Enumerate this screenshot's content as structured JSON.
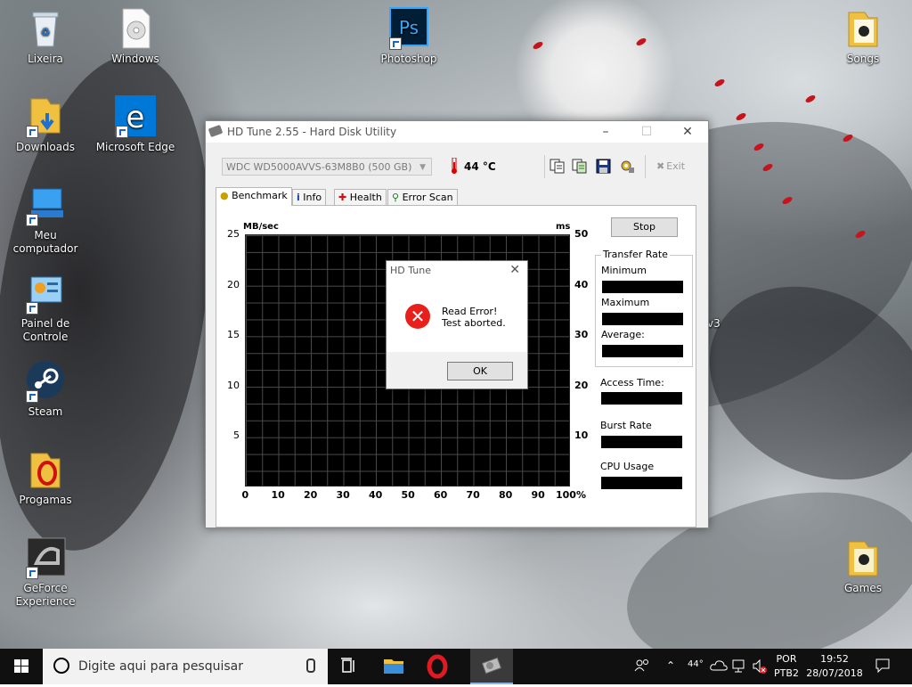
{
  "desktop": {
    "icons": [
      {
        "label": "Lixeira"
      },
      {
        "label": "Windows"
      },
      {
        "label": "Photoshop"
      },
      {
        "label": "Songs"
      },
      {
        "label": "Downloads"
      },
      {
        "label": "Microsoft Edge"
      },
      {
        "label": "Meu computador"
      },
      {
        "label": "Painel de Controle"
      },
      {
        "label": "Steam"
      },
      {
        "label": "Progamas"
      },
      {
        "label": "GeForce Experience"
      },
      {
        "label": "Games"
      }
    ],
    "partial_text": "v3"
  },
  "hdtune": {
    "title": "HD Tune 2.55 - Hard Disk Utility",
    "drive": "WDC WD5000AVVS-63M8B0 (500 GB)",
    "temperature": "44 °C",
    "exit_label": "Exit",
    "tabs": [
      {
        "label": "Benchmark",
        "icon": "benchmark-icon"
      },
      {
        "label": "Info",
        "icon": "info-icon"
      },
      {
        "label": "Health",
        "icon": "health-icon"
      },
      {
        "label": "Error Scan",
        "icon": "error-scan-icon"
      }
    ],
    "stop_label": "Stop",
    "stats": {
      "transfer_rate": "Transfer Rate",
      "minimum": "Minimum",
      "maximum": "Maximum",
      "average": "Average:",
      "access_time": "Access Time:",
      "burst_rate": "Burst Rate",
      "cpu_usage": "CPU Usage"
    }
  },
  "chart_data": {
    "type": "line",
    "ylabel": "MB/sec",
    "ylabel_right": "ms",
    "ylim": [
      0,
      25
    ],
    "ylim_right": [
      0,
      50
    ],
    "yticks_left": [
      "25",
      "20",
      "15",
      "10",
      "5"
    ],
    "yticks_right": [
      "50",
      "40",
      "30",
      "20",
      "10"
    ],
    "xticks": [
      "0",
      "10",
      "20",
      "30",
      "40",
      "50",
      "60",
      "70",
      "80",
      "90",
      "100%"
    ],
    "series": [],
    "grid": true
  },
  "dialog": {
    "title": "HD Tune",
    "line1": "Read Error!",
    "line2": "Test aborted.",
    "ok_label": "OK"
  },
  "taskbar": {
    "search_placeholder": "Digite aqui para pesquisar",
    "weather": "44°",
    "language_top": "POR",
    "language_bottom": "PTB2",
    "time": "19:52",
    "date": "28/07/2018"
  }
}
